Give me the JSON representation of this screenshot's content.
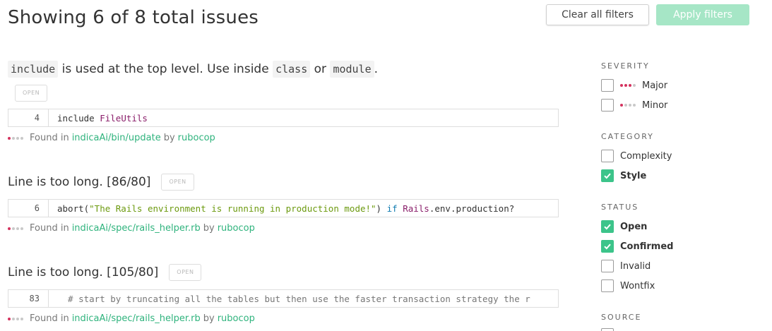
{
  "header": {
    "title": "Showing 6 of 8 total issues",
    "clear_label": "Clear all filters",
    "apply_label": "Apply filters"
  },
  "issues": [
    {
      "title_parts": [
        "include",
        " is used at the top level. Use inside ",
        "class",
        " or ",
        "module",
        "."
      ],
      "badge": "OPEN",
      "line_no": "4",
      "code": [
        "include ",
        "FileUtils"
      ],
      "found_prefix": "Found in",
      "path": "indicaAi/bin/update",
      "by": "by",
      "engine": "rubocop"
    },
    {
      "title": "Line is too long. [86/80]",
      "badge": "OPEN",
      "line_no": "6",
      "code": [
        "abort(",
        "\"The Rails environment is running in production mode!\"",
        ") ",
        "if",
        " ",
        "Rails",
        ".env.production?"
      ],
      "found_prefix": "Found in",
      "path": "indicaAi/spec/rails_helper.rb",
      "by": "by",
      "engine": "rubocop"
    },
    {
      "title": "Line is too long. [105/80]",
      "badge": "OPEN",
      "line_no": "83",
      "code": [
        "  # start by truncating all the tables but then use the faster transaction strategy the r"
      ],
      "found_prefix": "Found in",
      "path": "indicaAi/spec/rails_helper.rb",
      "by": "by",
      "engine": "rubocop"
    }
  ],
  "sidebar": {
    "severity": {
      "heading": "SEVERITY",
      "options": [
        {
          "label": "Major",
          "checked": false
        },
        {
          "label": "Minor",
          "checked": false
        }
      ]
    },
    "category": {
      "heading": "CATEGORY",
      "options": [
        {
          "label": "Complexity",
          "checked": false
        },
        {
          "label": "Style",
          "checked": true
        }
      ]
    },
    "status": {
      "heading": "STATUS",
      "options": [
        {
          "label": "Open",
          "checked": true
        },
        {
          "label": "Confirmed",
          "checked": true
        },
        {
          "label": "Invalid",
          "checked": false
        },
        {
          "label": "Wontfix",
          "checked": false
        }
      ]
    },
    "source": {
      "heading": "SOURCE"
    }
  },
  "colors": {
    "accent_green": "#3cc48a",
    "apply_disabled": "#a6e6c6",
    "link": "#2fb37d",
    "severity_dot": "#d4325e"
  }
}
